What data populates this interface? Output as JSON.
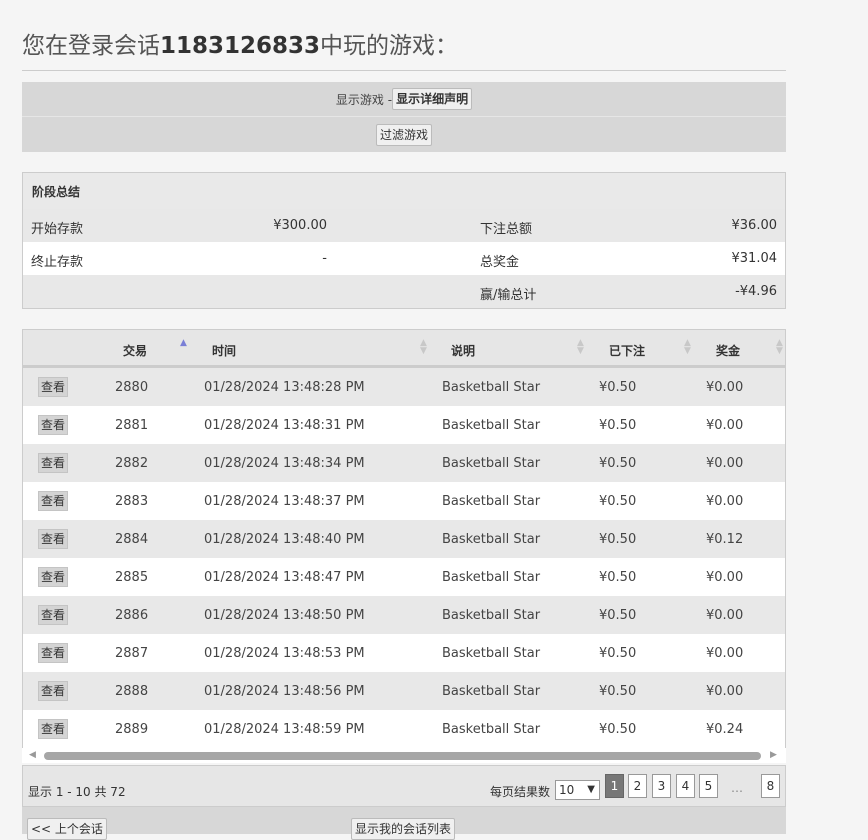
{
  "title": {
    "prefix": "您在登录会话",
    "session_id": "1183126833",
    "suffix": "中玩的游戏："
  },
  "controls": {
    "show_games_label": "显示游戏 - ",
    "show_detail_button": "显示详细声明",
    "filter_button": "过滤游戏"
  },
  "summary": {
    "heading": "阶段总结",
    "rows": [
      {
        "label1": "开始存款",
        "value1": "¥300.00",
        "label2": "下注总额",
        "value2": "¥36.00"
      },
      {
        "label1": "终止存款",
        "value1": "-",
        "label2": "总奖金",
        "value2": "¥31.04"
      },
      {
        "label1": "",
        "value1": "",
        "label2": "赢/输总计",
        "value2": "-¥4.96"
      }
    ]
  },
  "table": {
    "columns": [
      "交易",
      "时间",
      "说明",
      "已下注",
      "奖金"
    ],
    "view_label": "查看",
    "rows": [
      {
        "id": "2880",
        "time": "01/28/2024 13:48:28 PM",
        "desc": "Basketball Star",
        "bet": "¥0.50",
        "win": "¥0.00"
      },
      {
        "id": "2881",
        "time": "01/28/2024 13:48:31 PM",
        "desc": "Basketball Star",
        "bet": "¥0.50",
        "win": "¥0.00"
      },
      {
        "id": "2882",
        "time": "01/28/2024 13:48:34 PM",
        "desc": "Basketball Star",
        "bet": "¥0.50",
        "win": "¥0.00"
      },
      {
        "id": "2883",
        "time": "01/28/2024 13:48:37 PM",
        "desc": "Basketball Star",
        "bet": "¥0.50",
        "win": "¥0.00"
      },
      {
        "id": "2884",
        "time": "01/28/2024 13:48:40 PM",
        "desc": "Basketball Star",
        "bet": "¥0.50",
        "win": "¥0.12"
      },
      {
        "id": "2885",
        "time": "01/28/2024 13:48:47 PM",
        "desc": "Basketball Star",
        "bet": "¥0.50",
        "win": "¥0.00"
      },
      {
        "id": "2886",
        "time": "01/28/2024 13:48:50 PM",
        "desc": "Basketball Star",
        "bet": "¥0.50",
        "win": "¥0.00"
      },
      {
        "id": "2887",
        "time": "01/28/2024 13:48:53 PM",
        "desc": "Basketball Star",
        "bet": "¥0.50",
        "win": "¥0.00"
      },
      {
        "id": "2888",
        "time": "01/28/2024 13:48:56 PM",
        "desc": "Basketball Star",
        "bet": "¥0.50",
        "win": "¥0.00"
      },
      {
        "id": "2889",
        "time": "01/28/2024 13:48:59 PM",
        "desc": "Basketball Star",
        "bet": "¥0.50",
        "win": "¥0.24"
      }
    ]
  },
  "pager": {
    "info": "显示 1 - 10 共 72",
    "per_page_label": "每页结果数",
    "per_page_value": "10",
    "pages": [
      "1",
      "2",
      "3",
      "4",
      "5"
    ],
    "active_page": "1",
    "ellipsis": "…",
    "last_page": "8"
  },
  "bottom": {
    "prev_session": "<< 上个会话",
    "show_session_list": "显示我的会话列表"
  },
  "colors": {
    "accent_sort": "#7a7fd6",
    "active_page_bg": "#777777"
  }
}
